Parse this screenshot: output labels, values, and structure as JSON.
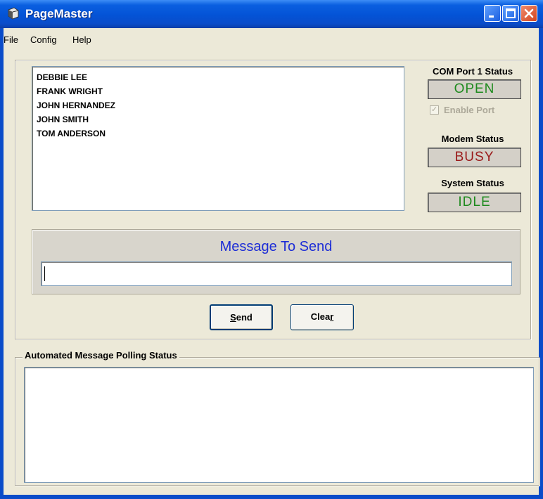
{
  "window": {
    "title": "PageMaster"
  },
  "menu": {
    "items": [
      "File",
      "Config",
      "Help"
    ]
  },
  "recipients": [
    "DEBBIE LEE",
    "FRANK WRIGHT",
    "JOHN HERNANDEZ",
    "JOHN SMITH",
    "TOM ANDERSON"
  ],
  "com_port": {
    "label": "COM Port 1 Status",
    "value": "OPEN",
    "color": "#1e8a1e"
  },
  "enable_port": {
    "label": "Enable Port",
    "checked": true,
    "enabled": false
  },
  "modem": {
    "label": "Modem Status",
    "value": "BUSY",
    "color": "#9a1a1a"
  },
  "system": {
    "label": "System Status",
    "value": "IDLE",
    "color": "#1e8a1e"
  },
  "message": {
    "title": "Message To Send",
    "value": ""
  },
  "buttons": {
    "send_prefix": "",
    "send_underline": "S",
    "send_rest": "end",
    "clear_prefix": "Clea",
    "clear_underline": "r",
    "clear_rest": ""
  },
  "polling": {
    "title": "Automated Message Polling Status"
  },
  "icons": {
    "app": "pager-icon",
    "minimize": "minimize-icon",
    "maximize": "maximize-icon",
    "close": "close-icon"
  }
}
